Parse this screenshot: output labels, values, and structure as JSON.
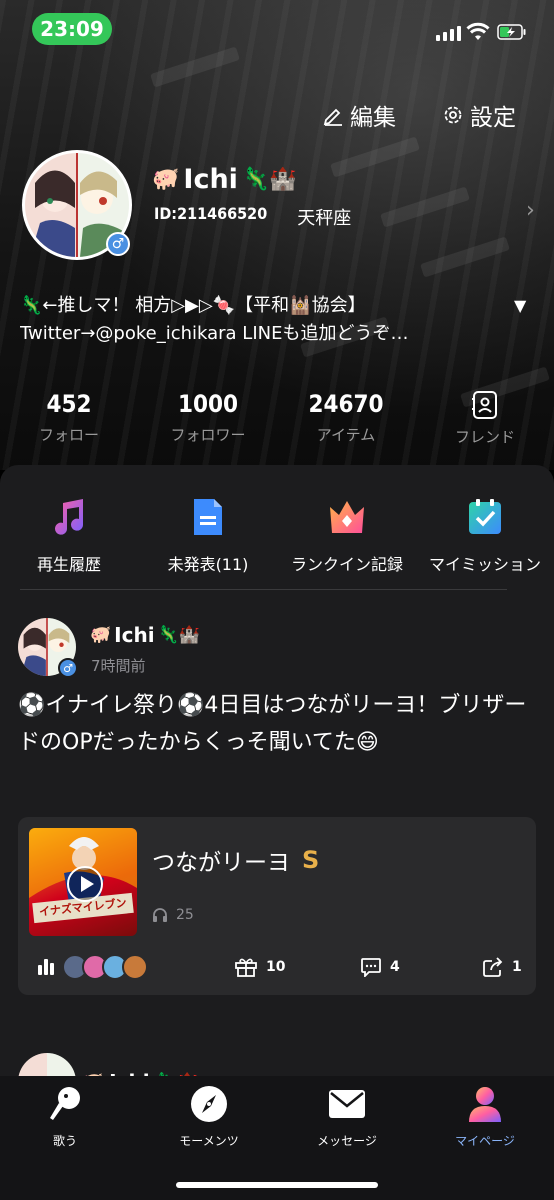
{
  "status_bar": {
    "time": "23:09"
  },
  "header": {
    "edit_label": "編集",
    "settings_label": "設定"
  },
  "profile": {
    "name_prefix_emoji": "🐖",
    "name": "Ichi",
    "name_suffix_emoji": "🦎🏰",
    "id": "ID:211466520",
    "zodiac": "天秤座",
    "gender": "♂",
    "bio_line1": "🦎←推しマ！ 相方▷▶︎▷🍬【平和🕍協会】",
    "bio_line2": "Twitter→@poke_ichikara LINEも追加どうぞ…"
  },
  "stats": [
    {
      "value": "452",
      "label": "フォロー"
    },
    {
      "value": "1000",
      "label": "フォロワー"
    },
    {
      "value": "24670",
      "label": "アイテム"
    },
    {
      "label": "フレンド"
    }
  ],
  "quick_actions": [
    {
      "label": "再生履歴",
      "icon": "music-note-icon"
    },
    {
      "label": "未発表(11)",
      "icon": "document-icon"
    },
    {
      "label": "ランクイン記録",
      "icon": "crown-icon"
    },
    {
      "label": "マイミッション",
      "icon": "mission-check-icon"
    }
  ],
  "post": {
    "author_prefix": "🐖",
    "author": "Ichi",
    "author_suffix": "🦎🏰",
    "time_ago": "7時間前",
    "text": "⚽イナイレ祭り⚽4日目はつながリーヨ！ブリザードのOPだったからくっそ聞いてた😄",
    "song": {
      "title": "つながリーヨ",
      "rank": "S",
      "listens": "25",
      "cover_text": "イナズマイレブン",
      "gifts": "10",
      "comments": "4",
      "shares": "1"
    }
  },
  "next_post": {
    "author_prefix": "🐖",
    "author": "Ichi",
    "author_suffix": "🦎🏰"
  },
  "tabs": [
    {
      "label": "歌う",
      "icon": "microphone-icon"
    },
    {
      "label": "モーメンツ",
      "icon": "compass-icon"
    },
    {
      "label": "メッセージ",
      "icon": "mail-icon"
    },
    {
      "label": "マイページ",
      "icon": "person-icon",
      "active": true
    }
  ],
  "colors": {
    "accent": "#8ab4f8",
    "time_pill": "#34c759",
    "rank": "#e8b04a",
    "card_bg": "#1c1c1e"
  }
}
